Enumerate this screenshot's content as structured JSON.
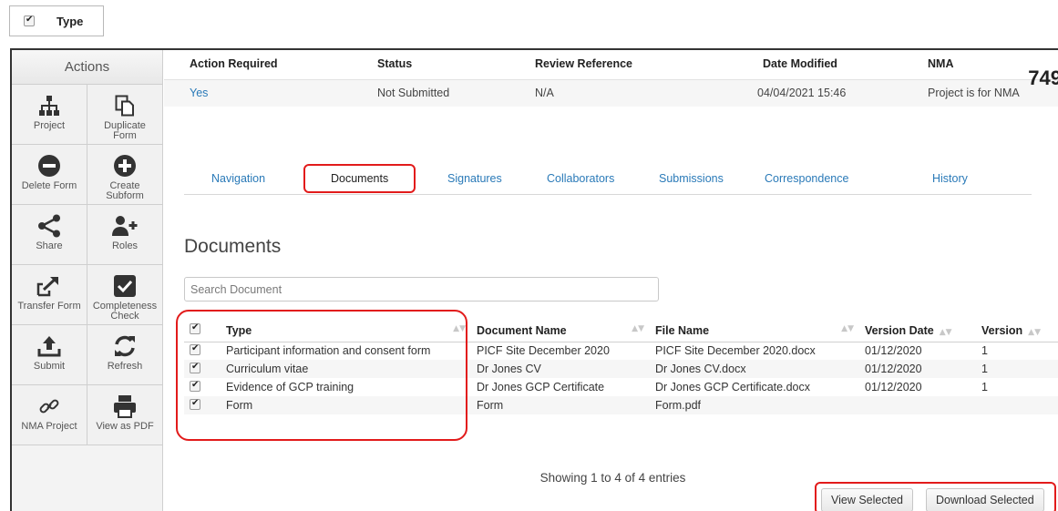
{
  "top_widget": {
    "label": "Type",
    "checked": true
  },
  "sidebar": {
    "title": "Actions",
    "items": [
      {
        "label": "Project",
        "icon": "sitemap-icon"
      },
      {
        "label": "Duplicate\nForm",
        "icon": "copy-icon"
      },
      {
        "label": "Delete Form",
        "icon": "minus-circle-icon"
      },
      {
        "label": "Create\nSubform",
        "icon": "plus-circle-icon"
      },
      {
        "label": "Share",
        "icon": "share-icon"
      },
      {
        "label": "Roles",
        "icon": "user-plus-icon"
      },
      {
        "label": "Transfer Form",
        "icon": "transfer-icon"
      },
      {
        "label": "Completeness\nCheck",
        "icon": "check-square-icon"
      },
      {
        "label": "Submit",
        "icon": "upload-icon"
      },
      {
        "label": "Refresh",
        "icon": "refresh-icon"
      },
      {
        "label": "NMA Project",
        "icon": "link-icon"
      },
      {
        "label": "View as PDF",
        "icon": "print-icon"
      }
    ]
  },
  "info": {
    "headers": [
      "Action Required",
      "Status",
      "Review Reference",
      "Date Modified",
      "NMA"
    ],
    "values": [
      "Yes",
      "Not Submitted",
      "N/A",
      "04/04/2021 15:46",
      "Project is for NMA"
    ],
    "number": "749"
  },
  "tabs": [
    "Navigation",
    "Documents",
    "Signatures",
    "Collaborators",
    "Submissions",
    "Correspondence",
    "History"
  ],
  "documents": {
    "title": "Documents",
    "search_placeholder": "Search Document",
    "columns": [
      "Type",
      "Document Name",
      "File Name",
      "Version Date",
      "Version"
    ],
    "rows": [
      [
        "Participant information and consent form",
        "PICF Site December 2020",
        "PICF Site December 2020.docx",
        "01/12/2020",
        "1"
      ],
      [
        "Curriculum vitae",
        "Dr Jones CV",
        "Dr Jones CV.docx",
        "01/12/2020",
        "1"
      ],
      [
        "Evidence of GCP training",
        "Dr Jones GCP Certificate",
        "Dr Jones GCP Certificate.docx",
        "01/12/2020",
        "1"
      ],
      [
        "Form",
        "Form",
        "Form.pdf",
        "",
        ""
      ]
    ],
    "showing": "Showing 1 to 4 of 4 entries"
  },
  "buttons": {
    "view_selected": "View Selected",
    "download_selected": "Download Selected"
  },
  "colors": {
    "highlight": "#e21b1b",
    "link": "#2a7ab8"
  }
}
